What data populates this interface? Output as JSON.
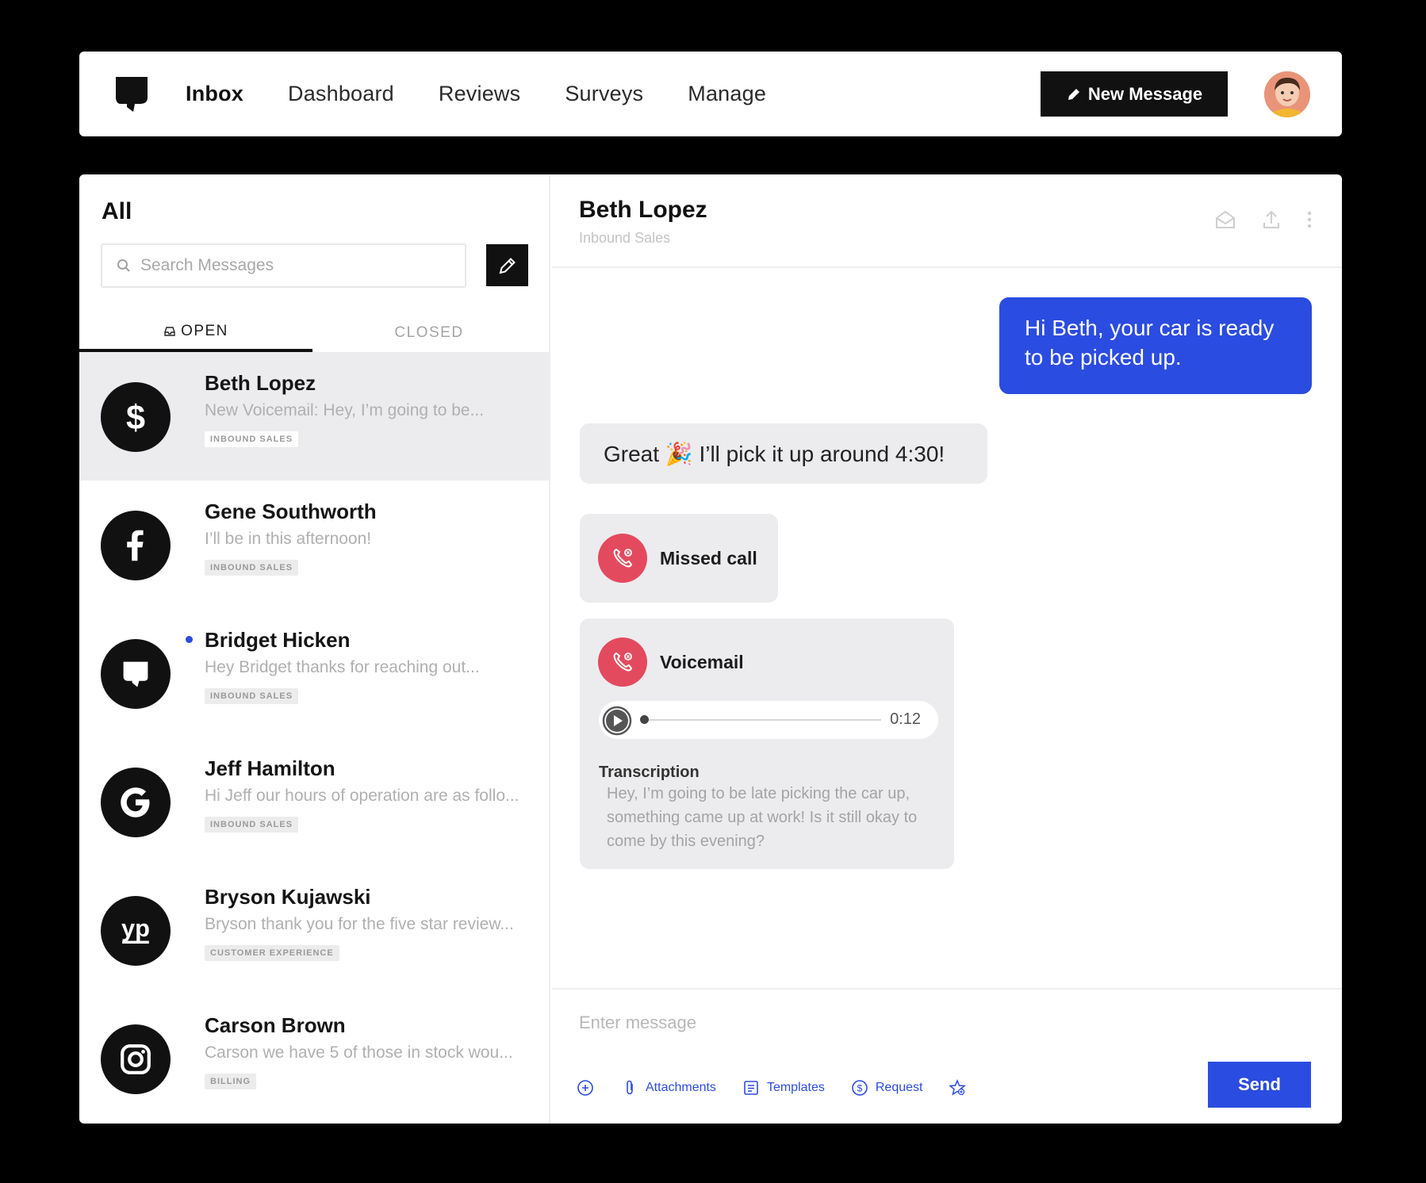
{
  "nav": {
    "items": [
      "Inbox",
      "Dashboard",
      "Reviews",
      "Surveys",
      "Manage"
    ],
    "active": "Inbox",
    "new_message_label": "New Message"
  },
  "sidebar": {
    "filter_title": "All",
    "search_placeholder": "Search Messages",
    "tabs": {
      "open": "OPEN",
      "closed": "CLOSED"
    },
    "conversations": [
      {
        "name": "Beth Lopez",
        "preview": "New Voicemail: Hey, I’m going to be...",
        "tag": "INBOUND SALES",
        "source_icon": "dollar-icon",
        "selected": true,
        "unread": false
      },
      {
        "name": "Gene Southworth",
        "preview": "I’ll be in this afternoon!",
        "tag": "INBOUND SALES",
        "source_icon": "facebook-icon",
        "selected": false,
        "unread": false
      },
      {
        "name": "Bridget Hicken",
        "preview": "Hey Bridget thanks for reaching out...",
        "tag": "INBOUND SALES",
        "source_icon": "podium-logo-icon",
        "selected": false,
        "unread": true
      },
      {
        "name": "Jeff Hamilton",
        "preview": "Hi Jeff our hours of operation are as follo...",
        "tag": "INBOUND SALES",
        "source_icon": "google-icon",
        "selected": false,
        "unread": false
      },
      {
        "name": "Bryson Kujawski",
        "preview": "Bryson thank you for the five star review...",
        "tag": "CUSTOMER EXPERIENCE",
        "source_icon": "yellow-pages-icon",
        "selected": false,
        "unread": false
      },
      {
        "name": "Carson Brown",
        "preview": "Carson we have 5 of those in stock wou...",
        "tag": "BILLING",
        "source_icon": "instagram-icon",
        "selected": false,
        "unread": false
      }
    ]
  },
  "conversation": {
    "contact_name": "Beth Lopez",
    "contact_sub": "Inbound Sales",
    "outgoing_message": "Hi Beth, your car is ready to be picked up.",
    "incoming_message": "Great 🎉 I’ll pick it up around 4:30!",
    "missed_call_label": "Missed call",
    "voicemail": {
      "label": "Voicemail",
      "duration": "0:12",
      "progress": 0.0,
      "transcription_label": "Transcription",
      "transcription": "Hey, I’m going to be late picking the car up, something came up at work! Is it still okay to come by this evening?"
    }
  },
  "composer": {
    "placeholder": "Enter message",
    "tools": {
      "attachments": "Attachments",
      "templates": "Templates",
      "request": "Request"
    },
    "send_label": "Send"
  },
  "colors": {
    "accent": "#2b4ce0",
    "missed": "#e44a5e",
    "dark": "#111111"
  }
}
